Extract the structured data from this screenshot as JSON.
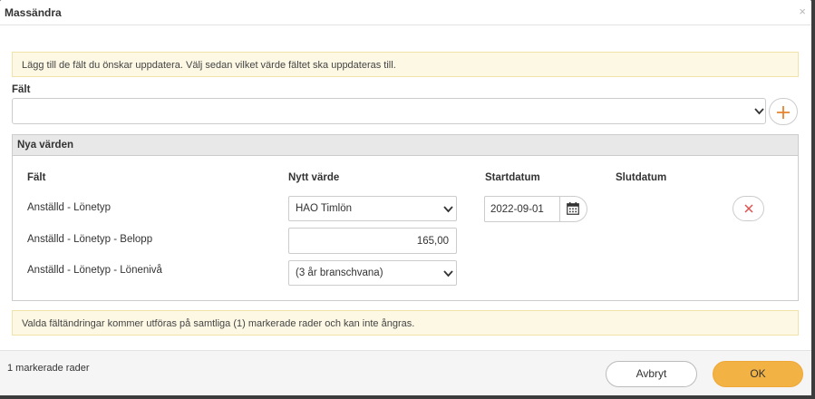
{
  "dialog": {
    "title": "Massändra",
    "close_glyph": "×",
    "info_top": "Lägg till de fält du önskar uppdatera. Välj sedan vilket värde fältet ska uppdateras till.",
    "field_label": "Fält",
    "field_value": "",
    "add_glyph": "+",
    "panel_title": "Nya värden",
    "columns": [
      "Fält",
      "Nytt värde",
      "Startdatum",
      "Slutdatum"
    ],
    "rows": [
      {
        "label": "Anställd - Lönetyp",
        "value": "HAO Timlön",
        "start_date": "2022-09-01"
      },
      {
        "label": "Anställd - Lönetyp - Belopp",
        "value": "165,00"
      },
      {
        "label": "Anställd - Lönetyp - Lönenivå",
        "value": "(3 år branschvana)"
      }
    ],
    "remove_glyph": "×",
    "info_bottom": "Valda fältändringar kommer utföras på samtliga (1) markerade rader och kan inte ångras.",
    "selected_count": "1 markerade rader",
    "cancel_label": "Avbryt",
    "ok_label": "OK"
  },
  "icons": {
    "chevron": "chevron-down-icon",
    "calendar": "calendar-icon",
    "plus": "plus-icon",
    "close": "close-icon"
  },
  "colors": {
    "accent": "#f3b244",
    "plus": "#e8822b",
    "remove": "#d9534f",
    "info_bg": "#fdf8e4"
  }
}
